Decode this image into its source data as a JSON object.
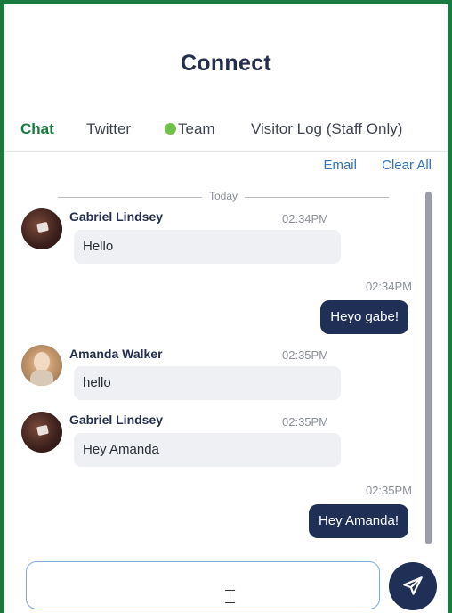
{
  "header": {
    "title": "Connect"
  },
  "tabs": [
    {
      "label": "Chat",
      "active": true
    },
    {
      "label": "Twitter"
    },
    {
      "label": "Team",
      "status_color": "#6fc24a"
    },
    {
      "label": "Visitor Log (Staff Only)"
    }
  ],
  "actions": {
    "email": "Email",
    "clear_all": "Clear All"
  },
  "day_separator": "Today",
  "messages": [
    {
      "sender": "Gabriel Lindsey",
      "time": "02:34PM",
      "text": "Hello",
      "direction": "in",
      "avatar": "gabriel-avatar"
    },
    {
      "time": "02:34PM",
      "text": "Heyo gabe!",
      "direction": "out"
    },
    {
      "sender": "Amanda Walker",
      "time": "02:35PM",
      "text": "hello",
      "direction": "in",
      "avatar": "amanda-avatar"
    },
    {
      "sender": "Gabriel Lindsey",
      "time": "02:35PM",
      "text": "Hey Amanda",
      "direction": "in",
      "avatar": "gabriel-avatar"
    },
    {
      "time": "02:35PM",
      "text": "Hey Amanda!",
      "direction": "out"
    }
  ],
  "composer": {
    "value": "",
    "placeholder": "",
    "send_icon": "send-icon"
  },
  "colors": {
    "accent": "#1a7a3f",
    "navy": "#1f2f55",
    "link": "#2f73c1"
  }
}
